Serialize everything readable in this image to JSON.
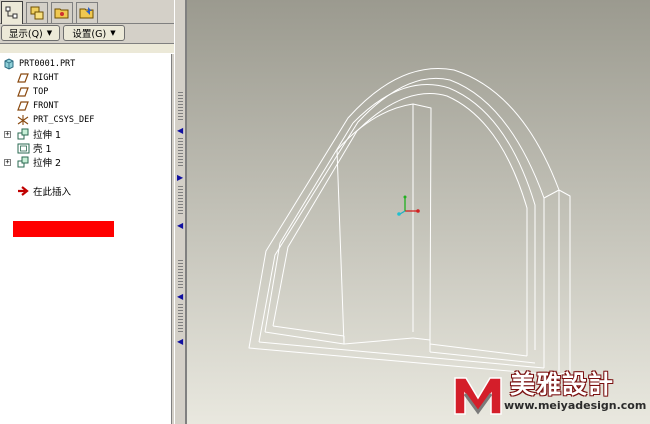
{
  "tabs": [
    {
      "icon": "model-tree-icon",
      "active": true
    },
    {
      "icon": "layers-icon",
      "active": false
    },
    {
      "icon": "folder-browser-icon",
      "active": false
    },
    {
      "icon": "favorites-icon",
      "active": false
    }
  ],
  "toolbar": {
    "show_label": "显示(Q)",
    "settings_label": "设置(G)"
  },
  "tree": {
    "root": {
      "label": "PRT0001.PRT",
      "icon": "part-icon"
    },
    "items": [
      {
        "label": "RIGHT",
        "icon": "datum-plane-icon"
      },
      {
        "label": "TOP",
        "icon": "datum-plane-icon"
      },
      {
        "label": "FRONT",
        "icon": "datum-plane-icon"
      },
      {
        "label": "PRT_CSYS_DEF",
        "icon": "coordinate-system-icon"
      },
      {
        "label": "拉伸 1",
        "icon": "extrude-icon"
      },
      {
        "label": "壳 1",
        "icon": "shell-icon"
      },
      {
        "label": "拉伸 2",
        "icon": "extrude-icon"
      },
      {
        "label": "在此插入",
        "icon": "insert-here-arrow-icon"
      }
    ],
    "redaction_color": "#ff0000"
  },
  "viewport": {
    "background_top": "#9b9a8f",
    "background_bottom": "#e9e8df",
    "edge_color": "#ffffff"
  },
  "watermark": {
    "title": "美雅設計",
    "url": "www.meiyadesign.com"
  }
}
